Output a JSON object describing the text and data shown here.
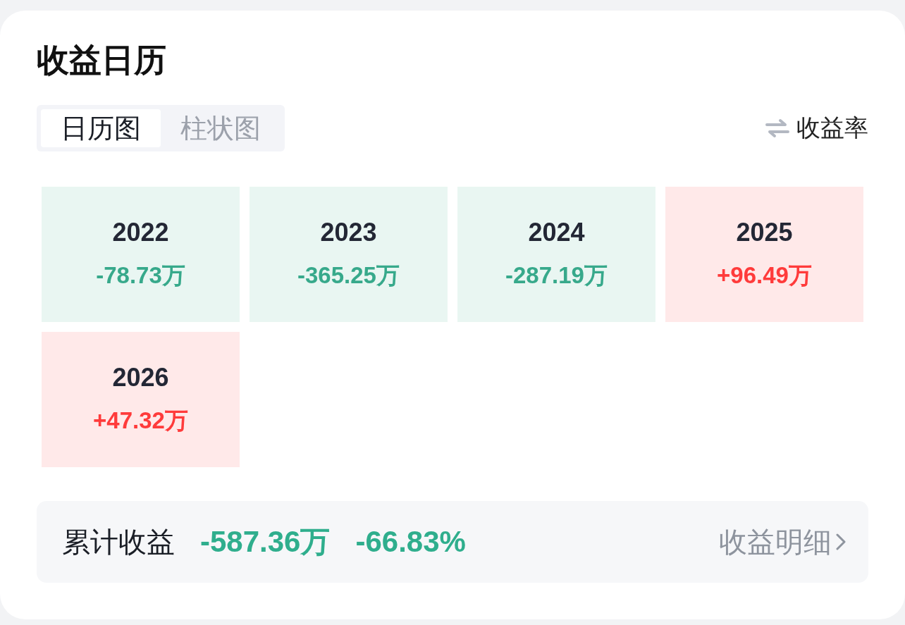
{
  "title": "收益日历",
  "tabs": [
    {
      "label": "日历图",
      "selected": true
    },
    {
      "label": "柱状图",
      "selected": false
    }
  ],
  "toggle": {
    "label": "收益率"
  },
  "years": [
    {
      "year": "2022",
      "value": "-78.73万",
      "color": "#37a98b"
    },
    {
      "year": "2023",
      "value": "-365.25万",
      "color": "#37a98b"
    },
    {
      "year": "2024",
      "value": "-287.19万",
      "color": "#37a98b"
    },
    {
      "year": "2025",
      "value": "+96.49万",
      "color": "#ff3b3b"
    },
    {
      "year": "2026",
      "value": "+47.32万",
      "color": "#ff3b3b"
    }
  ],
  "summary": {
    "label": "累计收益",
    "amount": "-587.36万",
    "rate": "-66.83%",
    "color": "#2fae8d",
    "link": "收益明细"
  }
}
